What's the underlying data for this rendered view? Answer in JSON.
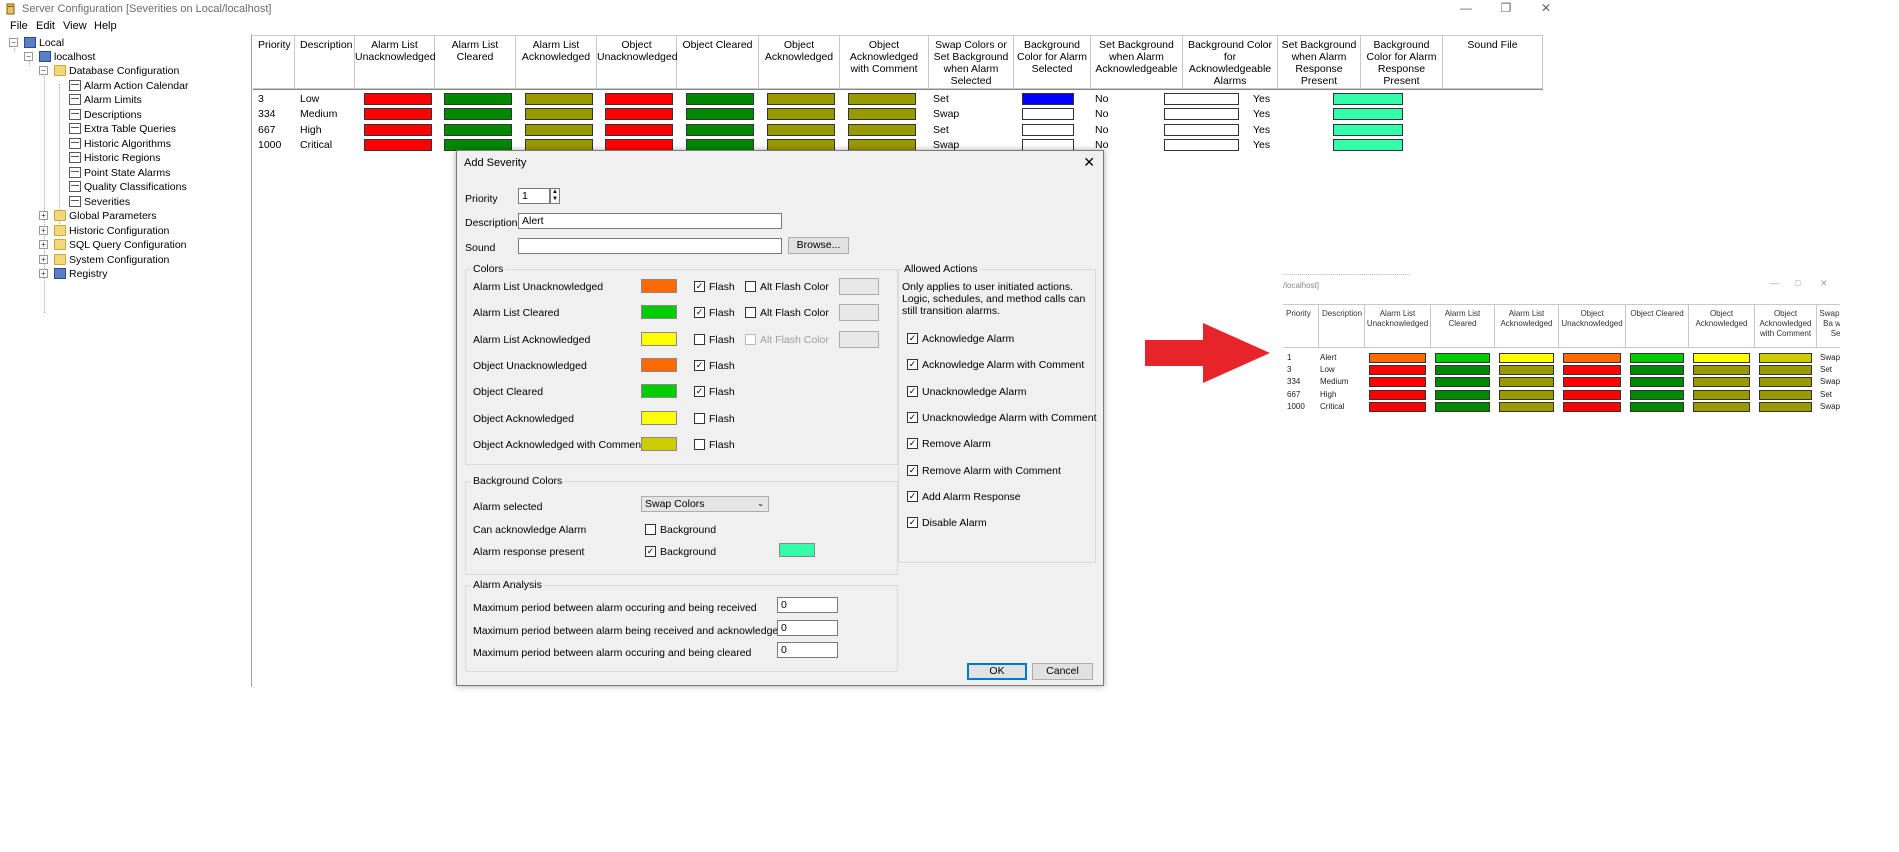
{
  "window": {
    "title": "Server Configuration [Severities on Local/localhost]"
  },
  "menu": [
    "File",
    "Edit",
    "View",
    "Help"
  ],
  "tree": {
    "local": "Local",
    "localhost": "localhost",
    "database_configuration": "Database Configuration",
    "db_items": [
      "Alarm Action Calendar",
      "Alarm Limits",
      "Descriptions",
      "Extra Table Queries",
      "Historic Algorithms",
      "Historic Regions",
      "Point State Alarms",
      "Quality Classifications",
      "Severities"
    ],
    "other_folders": [
      "Global Parameters",
      "Historic Configuration",
      "SQL Query Configuration",
      "System Configuration"
    ],
    "registry": "Registry"
  },
  "table": {
    "headers": [
      "Priority",
      "Description",
      "Alarm List Unacknowledged",
      "Alarm List Cleared",
      "Alarm List Acknowledged",
      "Object Unacknowledged",
      "Object Cleared",
      "Object Acknowledged",
      "Object Acknowledged with Comment",
      "Swap Colors or Set Background when Alarm Selected",
      "Background Color for Alarm Selected",
      "Set Background when Alarm Acknowledgeable",
      "Background Color for Acknowledgeable Alarms",
      "Set Background when Alarm Response Present",
      "Background Color for Alarm Response Present",
      "Sound File"
    ],
    "rows": [
      {
        "priority": "3",
        "description": "Low",
        "mode": "Set",
        "sel_bg": "#0000ff",
        "ack_bg_flag": "No",
        "resp_flag": "Yes"
      },
      {
        "priority": "334",
        "description": "Medium",
        "mode": "Swap",
        "sel_bg": "#ffffff",
        "ack_bg_flag": "No",
        "resp_flag": "Yes"
      },
      {
        "priority": "667",
        "description": "High",
        "mode": "Set",
        "sel_bg": "#ffffff",
        "ack_bg_flag": "No",
        "resp_flag": "Yes"
      },
      {
        "priority": "1000",
        "description": "Critical",
        "mode": "Swap",
        "sel_bg": "#ffffff",
        "ack_bg_flag": "No",
        "resp_flag": "Yes"
      }
    ],
    "colors": {
      "unack": "#ff0000",
      "cleared": "#008800",
      "ack": "#999900",
      "resp": "#33ffaa",
      "white": "#ffffff"
    }
  },
  "dialog": {
    "title": "Add Severity",
    "priority_label": "Priority",
    "priority_value": "1",
    "description_label": "Description",
    "description_value": "Alert",
    "sound_label": "Sound",
    "sound_value": "",
    "browse_label": "Browse...",
    "colors_group": "Colors",
    "color_rows": [
      {
        "label": "Alarm List Unacknowledged",
        "color": "#ff6a00",
        "flash": true,
        "alt": true,
        "alt_checked": false,
        "alt_disabled": false
      },
      {
        "label": "Alarm List Cleared",
        "color": "#00cc00",
        "flash": true,
        "alt": true,
        "alt_checked": false,
        "alt_disabled": false
      },
      {
        "label": "Alarm List Acknowledged",
        "color": "#ffff00",
        "flash": false,
        "alt": true,
        "alt_checked": false,
        "alt_disabled": true
      },
      {
        "label": "Object Unacknowledged",
        "color": "#ff6a00",
        "flash": true,
        "alt": false
      },
      {
        "label": "Object Cleared",
        "color": "#00cc00",
        "flash": true,
        "alt": false
      },
      {
        "label": "Object Acknowledged",
        "color": "#ffff00",
        "flash": false,
        "alt": false
      },
      {
        "label": "Object Acknowledged with Comment",
        "color": "#cccc00",
        "flash": false,
        "alt": false
      }
    ],
    "flash_label": "Flash",
    "alt_flash_label": "Alt Flash Color",
    "bg_group": "Background Colors",
    "alarm_selected_label": "Alarm selected",
    "alarm_selected_value": "Swap Colors",
    "can_ack_label": "Can acknowledge Alarm",
    "resp_present_label": "Alarm response present",
    "background_label": "Background",
    "resp_color": "#33ffaa",
    "analysis_group": "Alarm Analysis",
    "analysis_rows": [
      {
        "label": "Maximum period between alarm occuring and being received",
        "value": "0"
      },
      {
        "label": "Maximum period between alarm being received and acknowledged",
        "value": "0"
      },
      {
        "label": "Maximum period between alarm occuring and being cleared",
        "value": "0"
      }
    ],
    "allowed_group": "Allowed Actions",
    "allowed_note": "Only applies to user initiated actions. Logic, schedules, and method calls can still transition alarms.",
    "actions": [
      "Acknowledge Alarm",
      "Acknowledge Alarm with Comment",
      "Unacknowledge Alarm",
      "Unacknowledge Alarm with Comment",
      "Remove Alarm",
      "Remove Alarm with Comment",
      "Add Alarm Response",
      "Disable Alarm"
    ],
    "ok_label": "OK",
    "cancel_label": "Cancel"
  },
  "preview": {
    "title_fragment": "/localhost]",
    "headers": [
      "Priority",
      "Description",
      "Alarm List Unacknowledged",
      "Alarm List Cleared",
      "Alarm List Acknowledged",
      "Object Unacknowledged",
      "Object Cleared",
      "Object Acknowledged",
      "Object Acknowledged with Comment",
      "Swap Set Ba whe Sel"
    ],
    "rows": [
      {
        "priority": "1",
        "description": "Alert",
        "mode": "Swap",
        "c": [
          "#ff6a00",
          "#00cc00",
          "#ffff00",
          "#ff6a00",
          "#00cc00",
          "#ffff00",
          "#cccc00"
        ]
      },
      {
        "priority": "3",
        "description": "Low",
        "mode": "Set",
        "c": [
          "#ff0000",
          "#008800",
          "#999900",
          "#ff0000",
          "#008800",
          "#999900",
          "#999900"
        ]
      },
      {
        "priority": "334",
        "description": "Medium",
        "mode": "Swap",
        "c": [
          "#ff0000",
          "#008800",
          "#999900",
          "#ff0000",
          "#008800",
          "#999900",
          "#999900"
        ]
      },
      {
        "priority": "667",
        "description": "High",
        "mode": "Set",
        "c": [
          "#ff0000",
          "#008800",
          "#999900",
          "#ff0000",
          "#008800",
          "#999900",
          "#999900"
        ]
      },
      {
        "priority": "1000",
        "description": "Critical",
        "mode": "Swap",
        "c": [
          "#ff0000",
          "#008800",
          "#999900",
          "#ff0000",
          "#008800",
          "#999900",
          "#999900"
        ]
      }
    ]
  },
  "arrow_color": "#e8242b"
}
